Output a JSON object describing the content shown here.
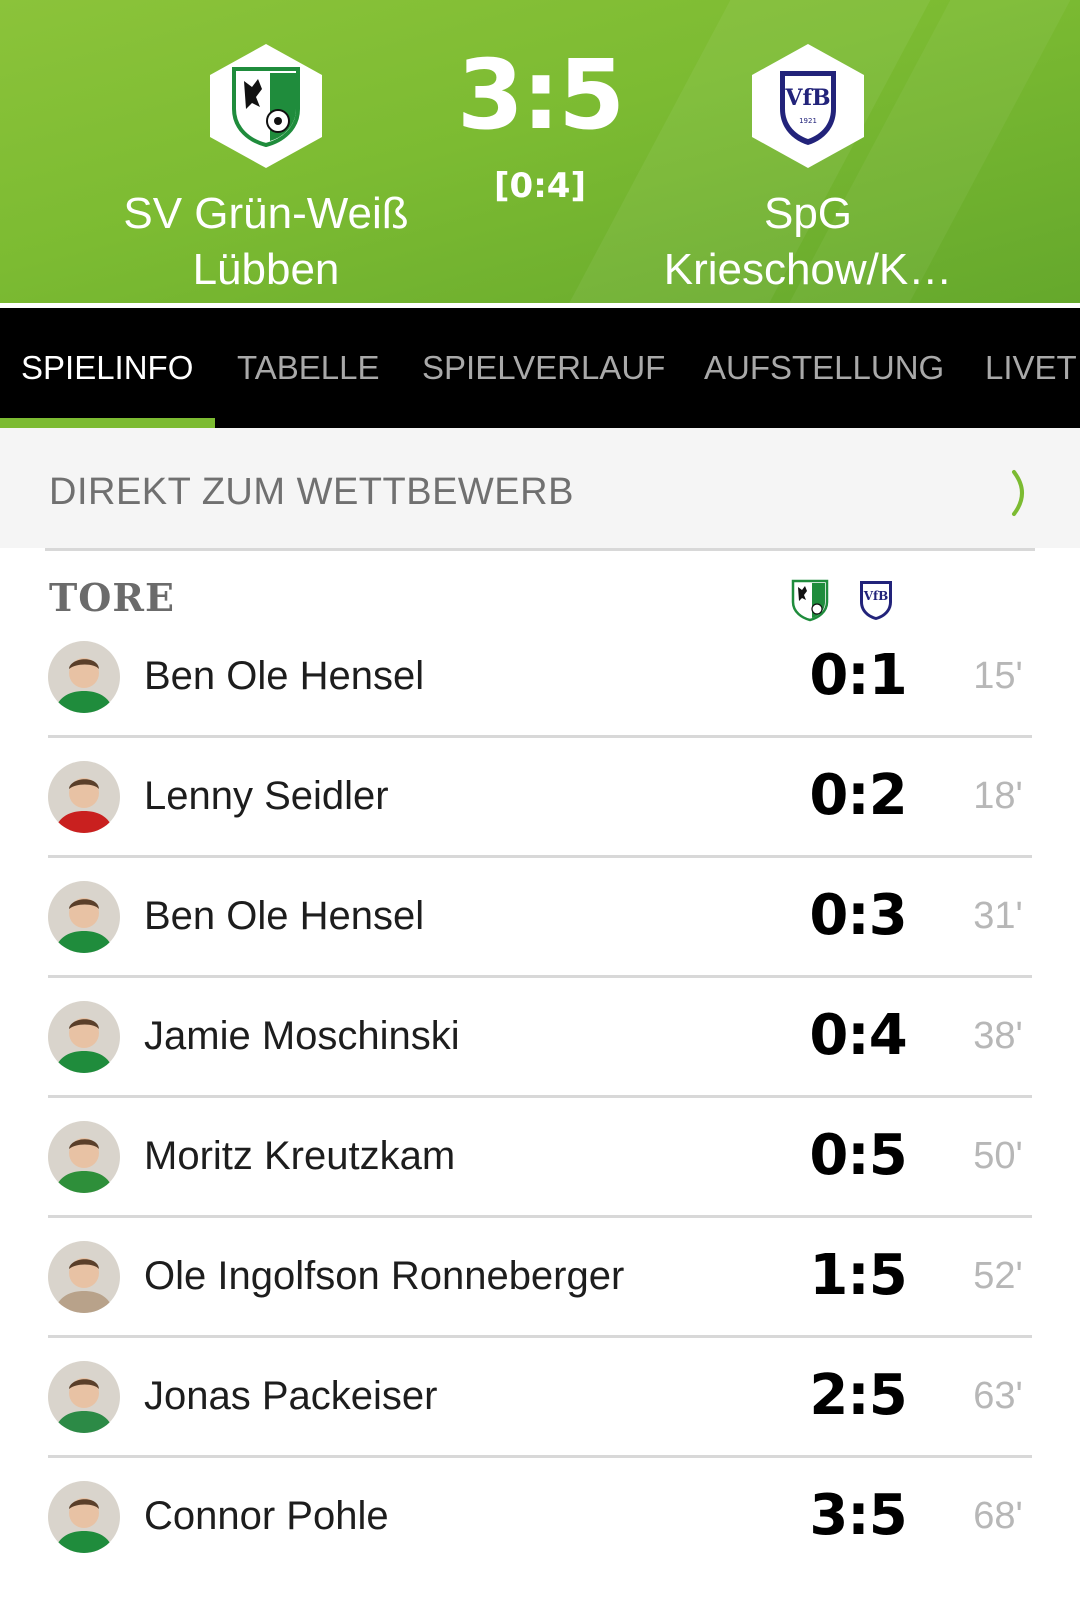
{
  "match": {
    "home_team": "SV Grün-Weiß\nLübben",
    "away_team": "SpG\nKrieschow/K…",
    "score": "3:5",
    "halftime": "[0:4]",
    "home_crest_icon": "gruen-weiss-crest-icon",
    "away_crest_icon": "vfb-krieschow-crest-icon",
    "home_color": "#1f8c3c",
    "away_color": "#22237a",
    "header_color": "#7cbb32"
  },
  "tabs": [
    {
      "label": "SPIELINFO",
      "active": true
    },
    {
      "label": "TABELLE",
      "active": false
    },
    {
      "label": "SPIELVERLAUF",
      "active": false
    },
    {
      "label": "AUFSTELLUNG",
      "active": false
    },
    {
      "label": "LIVET",
      "active": false
    }
  ],
  "competition_link": {
    "label": "DIREKT ZUM WETTBEWERB",
    "icon": "chevron-right-icon"
  },
  "goals": {
    "title": "TORE",
    "items": [
      {
        "player": "Ben Ole Hensel",
        "score": "0:1",
        "minute": "15'",
        "shirt_color": "#1f8c3c"
      },
      {
        "player": "Lenny Seidler",
        "score": "0:2",
        "minute": "18'",
        "shirt_color": "#c9201f"
      },
      {
        "player": "Ben Ole Hensel",
        "score": "0:3",
        "minute": "31'",
        "shirt_color": "#1f8c3c"
      },
      {
        "player": "Jamie Moschinski",
        "score": "0:4",
        "minute": "38'",
        "shirt_color": "#1f8c3c"
      },
      {
        "player": "Moritz Kreutzkam",
        "score": "0:5",
        "minute": "50'",
        "shirt_color": "#2e8f3a"
      },
      {
        "player": "Ole Ingolfson Ronneberger",
        "score": "1:5",
        "minute": "52'",
        "shirt_color": "#b8a28a"
      },
      {
        "player": "Jonas Packeiser",
        "score": "2:5",
        "minute": "63'",
        "shirt_color": "#2c8a46"
      },
      {
        "player": "Connor Pohle",
        "score": "3:5",
        "minute": "68'",
        "shirt_color": "#1f8c3c"
      }
    ]
  }
}
